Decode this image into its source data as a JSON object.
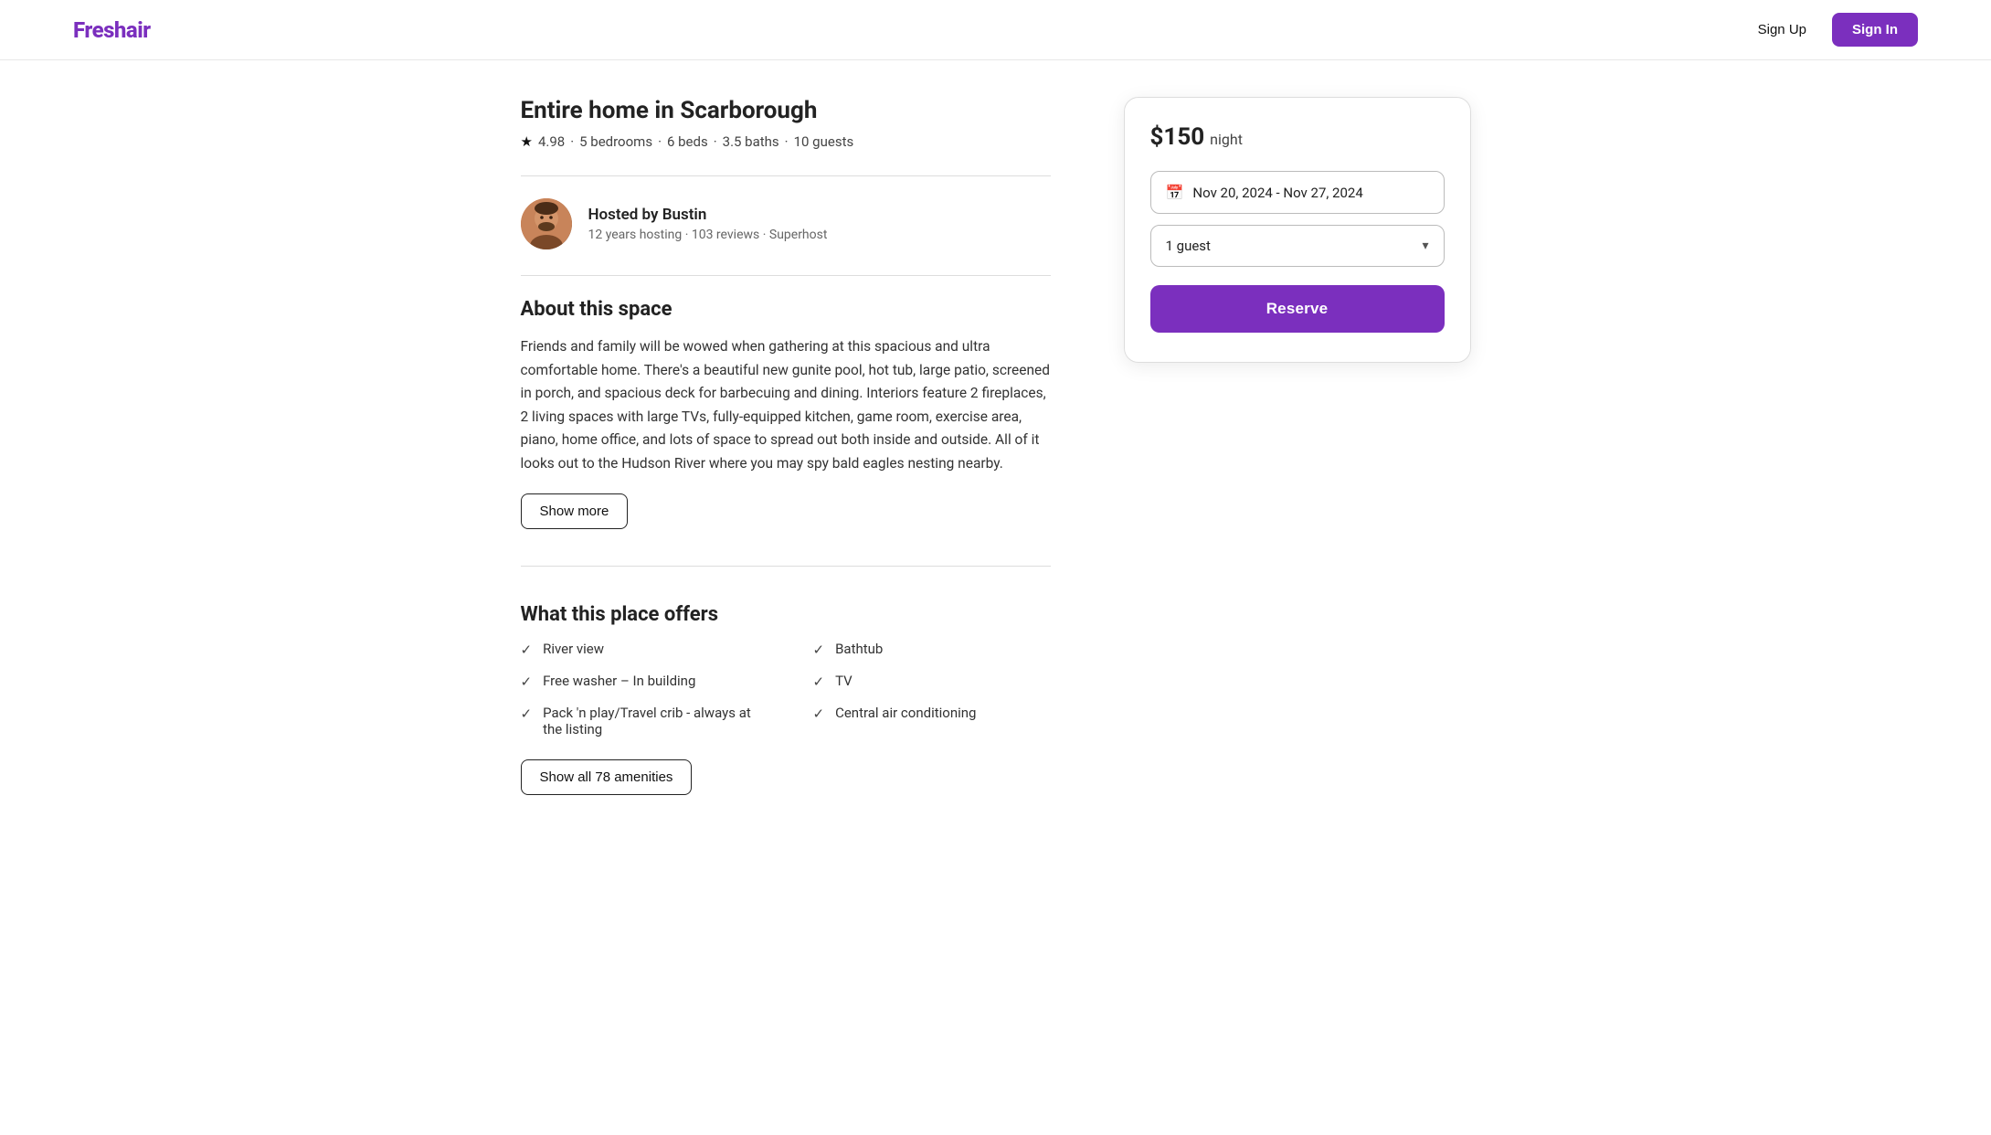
{
  "header": {
    "logo_text": "Fresh",
    "logo_accent": "air",
    "sign_up_label": "Sign Up",
    "sign_in_label": "Sign In"
  },
  "property": {
    "title": "Entire home in Scarborough",
    "rating": "4.98",
    "bedrooms": "5 bedrooms",
    "beds": "6 beds",
    "baths": "3.5 baths",
    "guests": "10 guests"
  },
  "host": {
    "hosted_by_label": "Hosted by Bustin",
    "years_hosting": "12 years hosting",
    "reviews": "103 reviews",
    "superhost": "Superhost"
  },
  "about": {
    "section_title": "About this space",
    "description": "Friends and family will be wowed when gathering at this spacious and ultra comfortable home. There's a beautiful new gunite pool, hot tub, large patio, screened in porch, and spacious deck for barbecuing and dining. Interiors feature 2 fireplaces, 2 living spaces with large TVs, fully-equipped kitchen, game room, exercise area, piano, home office, and lots of space to spread out both inside and outside. All of it looks out to the Hudson River where you may spy bald eagles nesting nearby.",
    "show_more_label": "Show more"
  },
  "amenities": {
    "section_title": "What this place offers",
    "items": [
      {
        "label": "River view",
        "col": 0
      },
      {
        "label": "Bathtub",
        "col": 1
      },
      {
        "label": "Free washer – In building",
        "col": 0
      },
      {
        "label": "TV",
        "col": 1
      },
      {
        "label": "Pack 'n play/Travel crib - always at the listing",
        "col": 0
      },
      {
        "label": "Central air conditioning",
        "col": 1
      }
    ],
    "show_all_label": "Show all 78 amenities"
  },
  "booking": {
    "price": "$150",
    "price_unit": "night",
    "date_label": "Nov 20, 2024 - Nov 27, 2024",
    "guest_label": "1 guest",
    "reserve_label": "Reserve"
  }
}
